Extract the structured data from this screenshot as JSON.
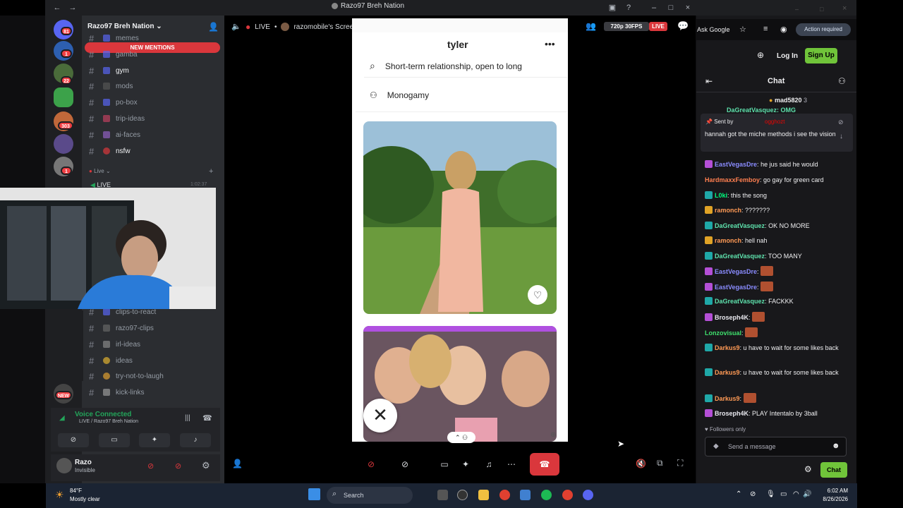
{
  "window": {
    "title": "Razo97 Breh Nation"
  },
  "discord": {
    "server_name": "Razo97 Breh Nation",
    "guild_badges": [
      "81",
      "1",
      "22",
      "303",
      "1"
    ],
    "new_mentions": "NEW MENTIONS",
    "channels_top": [
      {
        "name": "memes"
      },
      {
        "name": "gamba"
      },
      {
        "name": "gym"
      },
      {
        "name": "mods"
      },
      {
        "name": "po-box"
      },
      {
        "name": "trip-ideas"
      },
      {
        "name": "ai-faces"
      },
      {
        "name": "nsfw"
      }
    ],
    "live_category": "Live",
    "live_channel": "LIVE",
    "live_time": "1:02:37",
    "channels_bottom": [
      {
        "name": "clips-to-react"
      },
      {
        "name": "razo97-clips"
      },
      {
        "name": "irl-ideas"
      },
      {
        "name": "ideas"
      },
      {
        "name": "try-not-to-laugh"
      },
      {
        "name": "kick-links"
      }
    ],
    "new_badge": "NEW",
    "voice_title": "Voice Connected",
    "voice_sub": "LIVE / Razo97 Breh Nation",
    "user_name": "Razo",
    "user_status": "Invisible"
  },
  "stream": {
    "live_label": "LIVE",
    "screen_label": "razomobile's Screen",
    "quality": "720p 30FPS",
    "live_badge": "LIVE"
  },
  "phone": {
    "profile_name": "tyler",
    "pref1": "Short-term relationship, open to long",
    "pref2": "Monogamy"
  },
  "twitch": {
    "ask_google": "Ask Google",
    "action_required": "Action required",
    "login": "Log In",
    "signup": "Sign Up",
    "chat_title": "Chat",
    "top_user": "mad5820",
    "top_user_count": "3",
    "pinned_sent_by": "Sent by",
    "pinned_user": "ogghozt",
    "pinned_text": "hannah got the miche methods i see the vision",
    "messages": [
      {
        "user": "EastVegasDre",
        "text": "he jus said he would",
        "color": "#8a8cff",
        "badge": "#b44fd6"
      },
      {
        "user": "HardmaxxFemboy",
        "text": "go gay for green card",
        "color": "#ff7f50",
        "badge": ""
      },
      {
        "user": "L0ki",
        "text": "this the song",
        "color": "#00ff7f",
        "badge": "#1fa8a8"
      },
      {
        "user": "ramonch",
        "text": "???????",
        "color": "#ff9a55",
        "badge": "#e0a326"
      },
      {
        "user": "DaGreatVasquez",
        "text": "OK NO MORE",
        "color": "#5ee2ad",
        "badge": "#1fa8a8"
      },
      {
        "user": "ramonch",
        "text": "hell nah",
        "color": "#ff9a55",
        "badge": "#e0a326"
      },
      {
        "user": "DaGreatVasquez",
        "text": "TOO MANY",
        "color": "#5ee2ad",
        "badge": "#1fa8a8"
      },
      {
        "user": "EastVegasDre",
        "text": "",
        "color": "#8a8cff",
        "badge": "#b44fd6"
      },
      {
        "user": "EastVegasDre",
        "text": "",
        "color": "#8a8cff",
        "badge": "#b44fd6"
      },
      {
        "user": "DaGreatVasquez",
        "text": "FACKKK",
        "color": "#5ee2ad",
        "badge": "#1fa8a8"
      },
      {
        "user": "Broseph4K",
        "text": "",
        "color": "#e9e9ef",
        "badge": "#b44fd6"
      },
      {
        "user": "Lonzovisual",
        "text": "",
        "color": "#3fe06d",
        "badge": ""
      },
      {
        "user": "Darkus9",
        "text": "u have to wait for some likes back",
        "color": "#ff9a55",
        "badge": "#1fa8a8"
      },
      {
        "user": "Darkus9",
        "text": "u have to wait for some likes back",
        "color": "#ff9a55",
        "badge": "#1fa8a8"
      },
      {
        "user": "Darkus9",
        "text": "",
        "color": "#ff9a55",
        "badge": "#1fa8a8"
      },
      {
        "user": "Broseph4K",
        "text": "PLAY Intentalo by 3ball",
        "color": "#e9e9ef",
        "badge": "#b44fd6"
      }
    ],
    "followers_only": "Followers only",
    "input_placeholder": "Send a message",
    "chat_button": "Chat"
  },
  "taskbar": {
    "temp": "84°F",
    "weather": "Mostly clear",
    "search": "Search",
    "time": "6:02 AM",
    "date": "8/26/2026"
  },
  "colors": {
    "accent_green": "#70c43a",
    "discord_red": "#da373c",
    "voice_green": "#23a55a"
  }
}
